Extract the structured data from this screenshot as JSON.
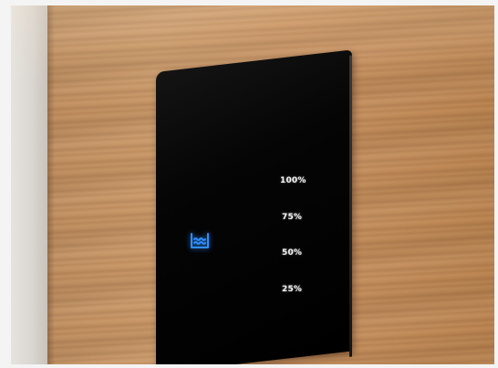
{
  "panel": {
    "icon": "water-level-icon",
    "icon_color": "#2f8fff",
    "levels": [
      "100%",
      "75%",
      "50%",
      "25%"
    ]
  }
}
